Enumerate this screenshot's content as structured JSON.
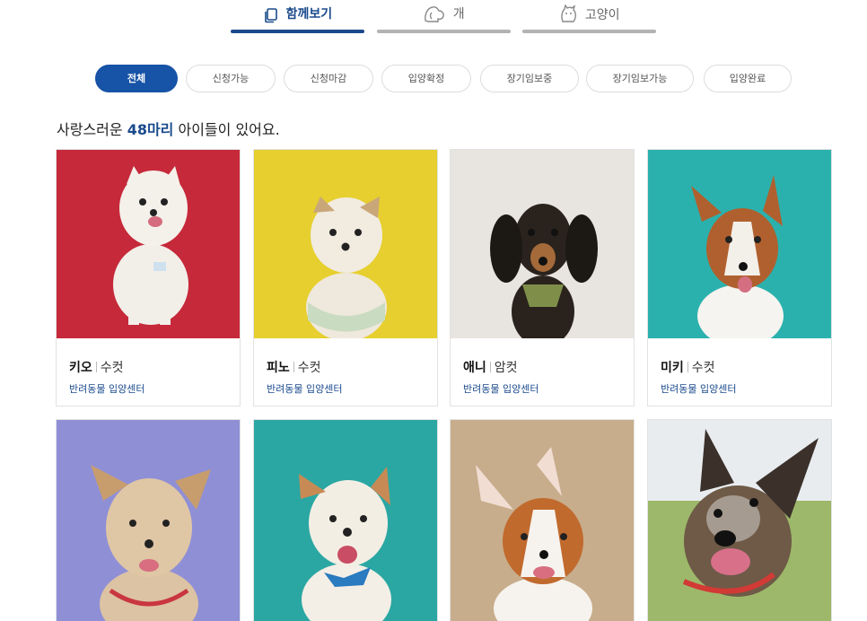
{
  "tabs": [
    {
      "label": "함께보기",
      "icon": "copy-icon",
      "active": true
    },
    {
      "label": "개",
      "icon": "dog-icon",
      "active": false
    },
    {
      "label": "고양이",
      "icon": "cat-icon",
      "active": false
    }
  ],
  "filters": [
    {
      "label": "전체",
      "active": true
    },
    {
      "label": "신청가능",
      "active": false
    },
    {
      "label": "신청마감",
      "active": false
    },
    {
      "label": "입양확정",
      "active": false
    },
    {
      "label": "장기임보중",
      "active": false
    },
    {
      "label": "장기임보가능",
      "active": false
    },
    {
      "label": "입양완료",
      "active": false
    }
  ],
  "count": {
    "prefix": "사랑스러운 ",
    "highlight": "48마리",
    "suffix": " 아이들이 있어요."
  },
  "cards": [
    {
      "name": "키오",
      "sex": "수컷",
      "center": "반려동물 입양센터",
      "bg": "#c6293a"
    },
    {
      "name": "피노",
      "sex": "수컷",
      "center": "반려동물 입양센터",
      "bg": "#e6cf2e"
    },
    {
      "name": "애니",
      "sex": "암컷",
      "center": "반려동물 입양센터",
      "bg": "#e8e4df"
    },
    {
      "name": "미키",
      "sex": "수컷",
      "center": "반려동물 입양센터",
      "bg": "#2bb1ad"
    },
    {
      "name": "",
      "sex": "",
      "center": "",
      "bg": "#8f8fd6"
    },
    {
      "name": "",
      "sex": "",
      "center": "",
      "bg": "#2aa7a3"
    },
    {
      "name": "",
      "sex": "",
      "center": "",
      "bg": "#c7ad8c"
    },
    {
      "name": "",
      "sex": "",
      "center": "",
      "bg": "#9db86a"
    }
  ],
  "colors": {
    "accent": "#1a4a8c",
    "pill_active": "#1753a6"
  }
}
